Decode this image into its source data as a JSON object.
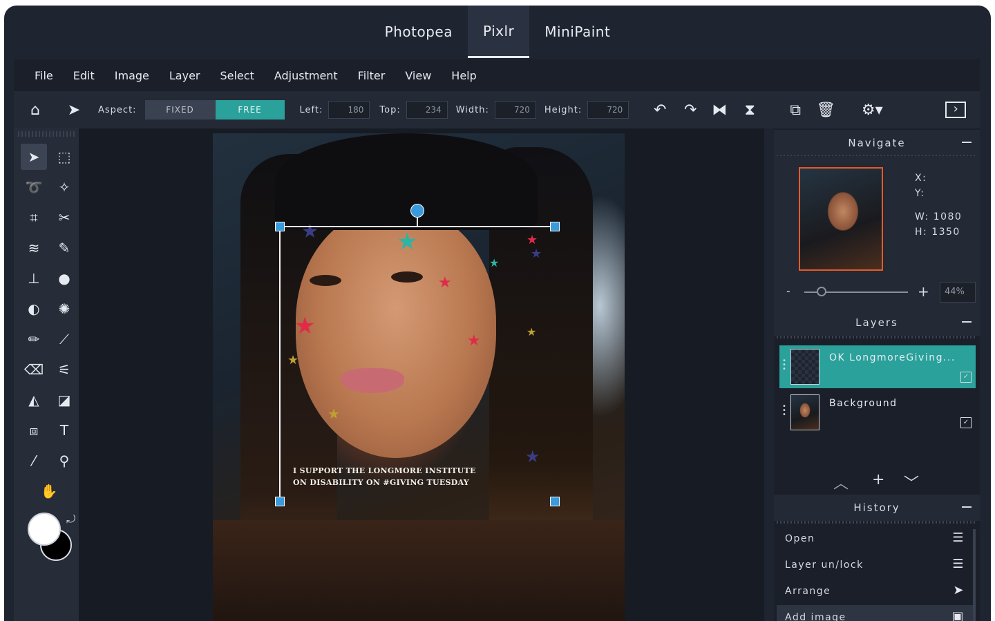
{
  "apps": [
    "Photopea",
    "Pixlr",
    "MiniPaint"
  ],
  "active_app": "Pixlr",
  "menu": [
    "File",
    "Edit",
    "Image",
    "Layer",
    "Select",
    "Adjustment",
    "Filter",
    "View",
    "Help"
  ],
  "toolbar": {
    "aspect_label": "Aspect:",
    "fixed_label": "FIXED",
    "free_label": "FREE",
    "left_label": "Left:",
    "left_value": "180",
    "top_label": "Top:",
    "top_value": "234",
    "width_label": "Width:",
    "width_value": "720",
    "height_label": "Height:",
    "height_value": "720"
  },
  "canvas": {
    "caption_line1": "I SUPPORT THE LONGMORE INSTITUTE",
    "caption_line2": "ON DISABILITY ON #GIVING TUESDAY"
  },
  "navigate": {
    "title": "Navigate",
    "x_label": "X:",
    "y_label": "Y:",
    "w_text": "W:  1080",
    "h_text": "H:  1350",
    "zoom_minus": "-",
    "zoom_plus": "+",
    "zoom_value": "44%"
  },
  "layers": {
    "title": "Layers",
    "items": [
      {
        "name": "OK LongmoreGiving..."
      },
      {
        "name": "Background"
      }
    ]
  },
  "history": {
    "title": "History",
    "items": [
      "Open",
      "Layer un/lock",
      "Arrange",
      "Add image"
    ]
  },
  "colors": {
    "accent": "#2aa19a",
    "handle": "#3a9bdc",
    "thumb_border": "#e35b2a"
  },
  "icons": [
    "home-icon",
    "pointer-icon",
    "undo-icon",
    "redo-icon",
    "flip-horizontal-icon",
    "flip-vertical-icon",
    "duplicate-icon",
    "trash-icon",
    "gear-icon",
    "panel-toggle-icon"
  ]
}
